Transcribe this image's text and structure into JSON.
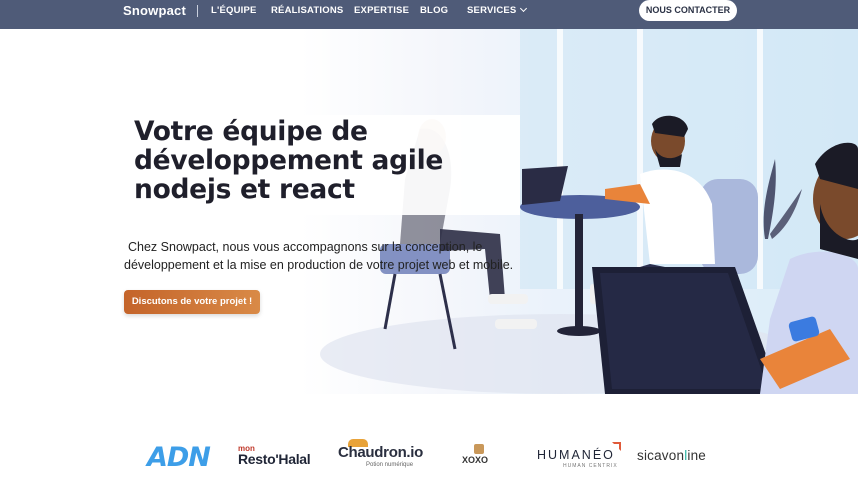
{
  "nav": {
    "brand": "Snowpact",
    "links": [
      "L'ÉQUIPE",
      "RÉALISATIONS",
      "EXPERTISE",
      "BLOG",
      "SERVICES"
    ],
    "cta": "NOUS CONTACTER"
  },
  "hero": {
    "title": "Votre équipe de développement agile nodejs et react",
    "subtitle": "Chez Snowpact, nous vous accompagnons sur la conception, le développement et la mise en production de votre projet web et mobile.",
    "button": "Discutons de votre projet !"
  },
  "logos": {
    "adn": "ADN",
    "resto_mon": "mon",
    "resto": "Resto'Halal",
    "chaudron": "Chaudron.io",
    "chaudron_sub": "Potion numérique",
    "xoxo": "XOXO",
    "humaneo": "HUMANÉO",
    "humaneo_sub": "HUMAN CENTRIX",
    "sicav_a": "sicavon",
    "sicav_b": "l",
    "sicav_c": "ine"
  },
  "colors": {
    "nav_bg": "#4f5b78",
    "accent_orange": "#c4642a",
    "illustration_blue": "#5b6fae"
  }
}
